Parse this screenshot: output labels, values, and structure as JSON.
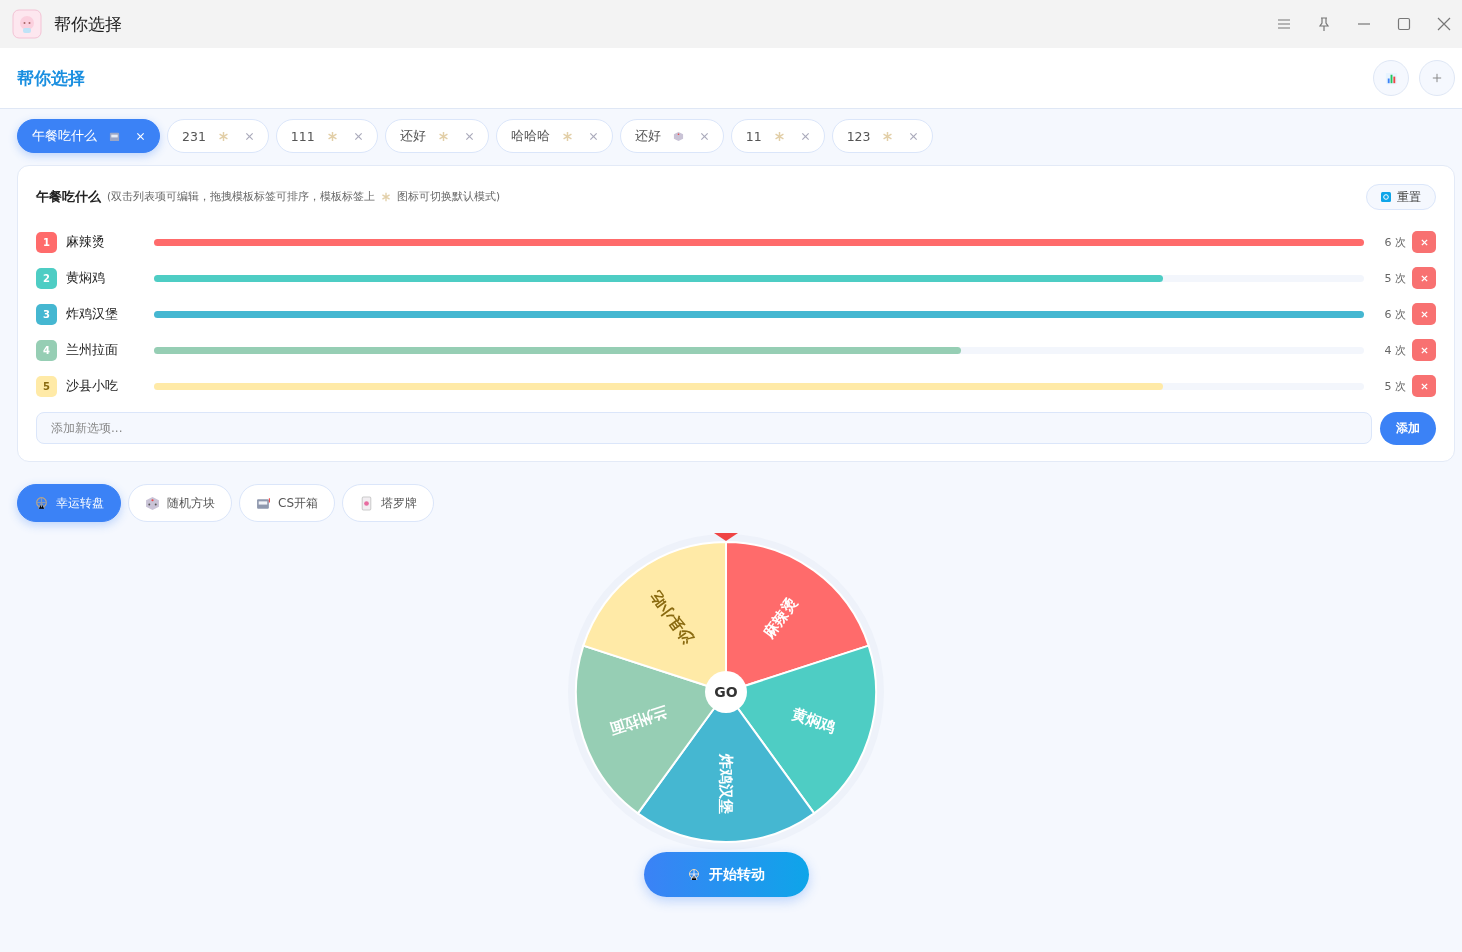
{
  "window": {
    "title": "帮你选择"
  },
  "header": {
    "title": "帮你选择"
  },
  "templates": [
    {
      "label": "午餐吃什么",
      "selected": true,
      "kind": "slot"
    },
    {
      "label": "231",
      "selected": false,
      "kind": "default"
    },
    {
      "label": "111",
      "selected": false,
      "kind": "default"
    },
    {
      "label": "还好",
      "selected": false,
      "kind": "default"
    },
    {
      "label": "哈哈哈",
      "selected": false,
      "kind": "default"
    },
    {
      "label": "还好",
      "selected": false,
      "kind": "dice"
    },
    {
      "label": "11",
      "selected": false,
      "kind": "default"
    },
    {
      "label": "123",
      "selected": false,
      "kind": "default"
    }
  ],
  "panel": {
    "title": "午餐吃什么",
    "hint_before": "(双击列表项可编辑，拖拽模板标签可排序，模板标签上",
    "hint_after": "图标可切换默认模式)",
    "reset": "重置",
    "options": [
      {
        "index": "1",
        "name": "麻辣烫",
        "color": "#ff6b6b",
        "level": 1,
        "count": "6 次"
      },
      {
        "index": "2",
        "name": "黄焖鸡",
        "color": "#4ecdc4",
        "level": 0.834,
        "count": "5 次"
      },
      {
        "index": "3",
        "name": "炸鸡汉堡",
        "color": "#45b7d1",
        "level": 1,
        "count": "6 次"
      },
      {
        "index": "4",
        "name": "兰州拉面",
        "color": "#96ceb4",
        "level": 0.667,
        "count": "4 次"
      },
      {
        "index": "5",
        "name": "沙县小吃",
        "color": "#ffeaa7",
        "level": 0.834,
        "count": "5 次"
      }
    ],
    "add_placeholder": "添加新选项...",
    "add_button": "添加"
  },
  "modes": [
    {
      "label": "幸运转盘",
      "selected": true,
      "kind": "wheel"
    },
    {
      "label": "随机方块",
      "selected": false,
      "kind": "dice"
    },
    {
      "label": "CS开箱",
      "selected": false,
      "kind": "slot"
    },
    {
      "label": "塔罗牌",
      "selected": false,
      "kind": "tarot"
    }
  ],
  "wheel": {
    "center": "GO",
    "slices": [
      "麻辣烫",
      "黄焖鸡",
      "炸鸡汉堡",
      "兰州拉面",
      "沙县小吃"
    ]
  },
  "spin_button": "开始转动"
}
